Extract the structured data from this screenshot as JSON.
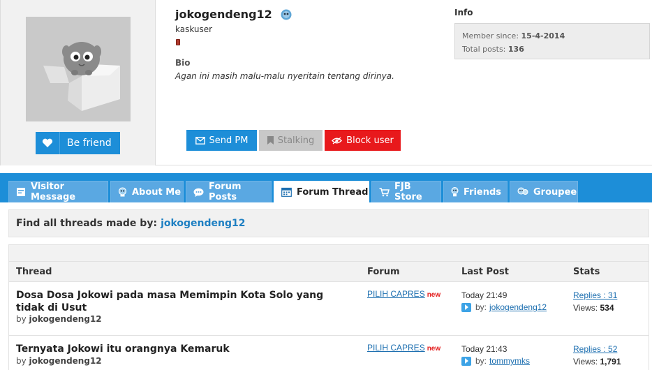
{
  "profile": {
    "username": "jokogendeng12",
    "user_title": "kaskuser",
    "befriend_label": "Be friend",
    "bio_heading": "Bio",
    "bio_text": "Agan ini masih malu-malu nyeritain tentang dirinya.",
    "actions": {
      "send_pm": "Send PM",
      "stalking": "Stalking",
      "block_user": "Block user"
    },
    "info_heading": "Info",
    "member_since_label": "Member since:",
    "member_since_value": "15-4-2014",
    "total_posts_label": "Total posts:",
    "total_posts_value": "136"
  },
  "tabs": [
    {
      "label": "Visitor Message",
      "icon": "visitor-message-icon"
    },
    {
      "label": "About Me",
      "icon": "about-me-icon"
    },
    {
      "label": "Forum Posts",
      "icon": "forum-posts-icon"
    },
    {
      "label": "Forum Thread",
      "icon": "calendar-icon",
      "active": true
    },
    {
      "label": "FJB Store",
      "icon": "cart-icon"
    },
    {
      "label": "Friends",
      "icon": "friends-icon"
    },
    {
      "label": "Groupee",
      "icon": "groupee-icon"
    }
  ],
  "find": {
    "label": "Find all threads made by:",
    "user": "jokogendeng12"
  },
  "table": {
    "columns": [
      "Thread",
      "Forum",
      "Last Post",
      "Stats"
    ],
    "rows": [
      {
        "title": "Dosa Dosa Jokowi pada masa Memimpin Kota Solo yang tidak di Usut",
        "by_label": "by",
        "author": "jokogendeng12",
        "forum": "PILIH CAPRES",
        "forum_badge": "new",
        "last_post_time": "Today 21:49",
        "last_post_by_label": "by:",
        "last_post_user": "jokogendeng12",
        "replies": "Replies : 31",
        "views_label": "Views:",
        "views": "534"
      },
      {
        "title": "Ternyata Jokowi itu orangnya Kemaruk",
        "by_label": "by",
        "author": "jokogendeng12",
        "forum": "PILIH CAPRES",
        "forum_badge": "new",
        "last_post_time": "Today 21:43",
        "last_post_by_label": "by:",
        "last_post_user": "tommymks",
        "replies": "Replies : 52",
        "views_label": "Views:",
        "views": "1,791"
      }
    ]
  },
  "colors": {
    "accent": "#1d8ed8",
    "tab_inactive": "#5aa8e2",
    "block_red": "#e8191c",
    "new_badge": "#e31b1b",
    "link": "#1d6fb0"
  }
}
